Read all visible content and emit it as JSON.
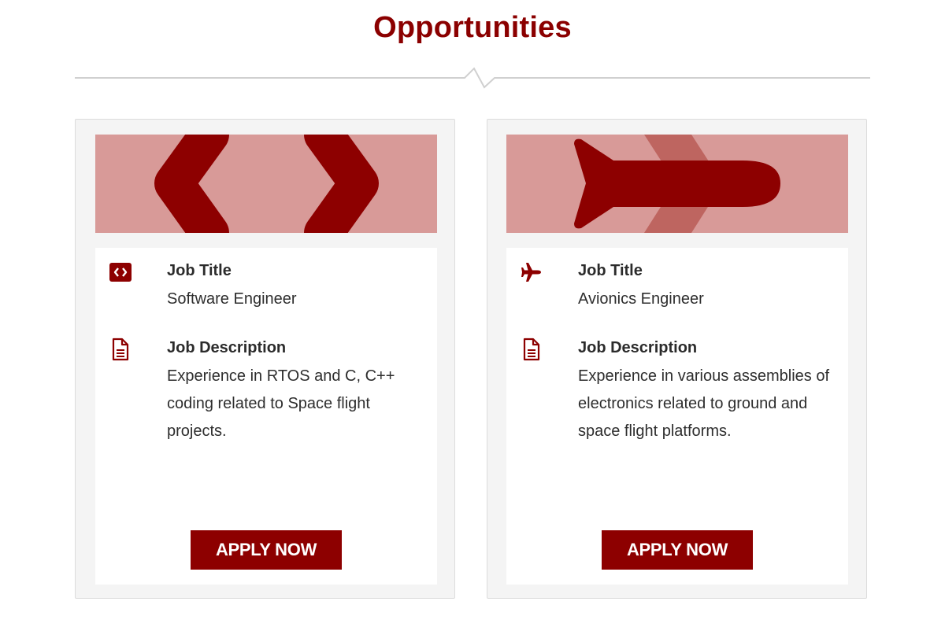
{
  "page": {
    "title": "Opportunities"
  },
  "colors": {
    "accent": "#8d0000",
    "banner_bg": "#d89a98",
    "banner_shadow": "#be6560",
    "card_bg": "#f4f4f4",
    "divider": "#d0d0d0"
  },
  "jobs": [
    {
      "banner_icon": "code-icon",
      "title_icon": "code-icon",
      "title_label": "Job Title",
      "title_value": "Software Engineer",
      "desc_icon": "document-icon",
      "desc_label": "Job Description",
      "desc_value": "Experience in RTOS and C, C++ coding related to Space flight projects.",
      "apply_label": "APPLY NOW"
    },
    {
      "banner_icon": "airplane-icon",
      "title_icon": "airplane-icon",
      "title_label": "Job Title",
      "title_value": "Avionics Engineer",
      "desc_icon": "document-icon",
      "desc_label": "Job Description",
      "desc_value": "Experience in various assemblies of electronics related to ground and space flight platforms.",
      "apply_label": "APPLY NOW"
    }
  ]
}
